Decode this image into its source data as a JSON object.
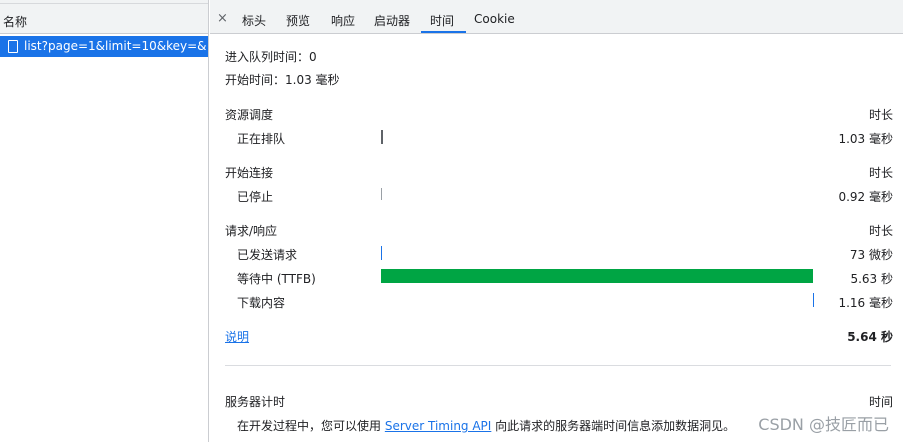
{
  "request_list": {
    "header": "名称",
    "selected_request": "list?page=1&limit=10&key=&o..."
  },
  "tabs": [
    {
      "label": "标头"
    },
    {
      "label": "预览"
    },
    {
      "label": "响应"
    },
    {
      "label": "启动器"
    },
    {
      "label": "时间",
      "active": true
    },
    {
      "label": "Cookie"
    }
  ],
  "close_glyph": "×",
  "timing": {
    "queued_at": "进入队列时间：0",
    "started_at": "开始时间：1.03 毫秒",
    "sections": [
      {
        "title": "资源调度",
        "duration_header": "时长",
        "rows": [
          {
            "label": "正在排队",
            "duration": "1.03 毫秒"
          }
        ]
      },
      {
        "title": "开始连接",
        "duration_header": "时长",
        "rows": [
          {
            "label": "已停止",
            "duration": "0.92 毫秒"
          }
        ]
      },
      {
        "title": "请求/响应",
        "duration_header": "时长",
        "rows": [
          {
            "label": "已发送请求",
            "duration": "73 微秒"
          },
          {
            "label": "等待中 (TTFB)",
            "duration": "5.63 秒"
          },
          {
            "label": "下载内容",
            "duration": "1.16 毫秒"
          }
        ]
      }
    ],
    "explanation_link": "说明",
    "total": "5.64 秒",
    "server_timing": {
      "title": "服务器计时",
      "time_header": "时间",
      "text_before": "在开发过程中，您可以使用 ",
      "link": "Server Timing API",
      "text_after": " 向此请求的服务器端时间信息添加数据洞见。"
    }
  },
  "colors": {
    "accent": "#1a73e8",
    "ttfb_bar": "#00a544",
    "queue_bar": "#5f6368",
    "stalled_bar": "#9aa0a6"
  },
  "watermark": "CSDN @技匠而已"
}
